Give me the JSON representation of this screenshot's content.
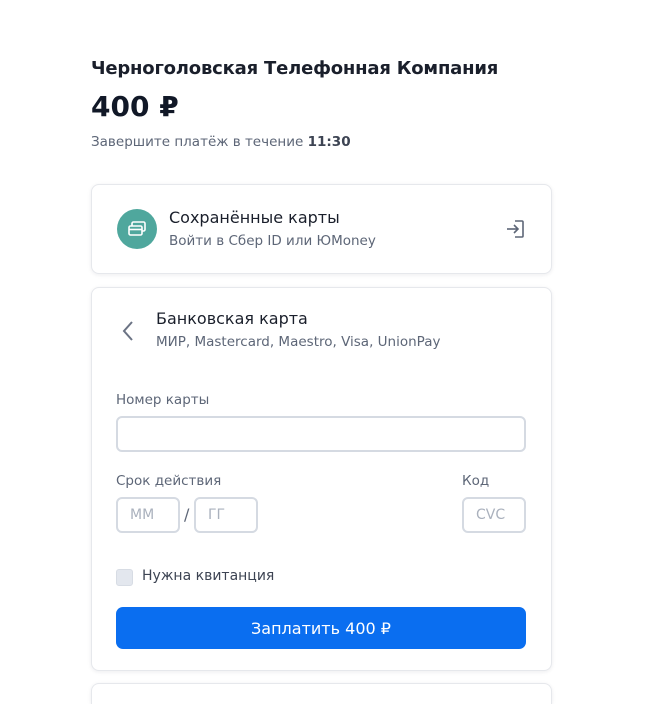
{
  "header": {
    "merchant": "Черноголовская Телефонная Компания",
    "amount": "400 ₽",
    "timer_text": "Завершите платёж в течение",
    "timer_value": "11:30"
  },
  "saved_cards": {
    "title": "Сохранённые карты",
    "subtitle": "Войти в Сбер ID или ЮMoney",
    "icon": "card-icon",
    "login_icon": "login-icon",
    "accent": "#4fa79d"
  },
  "bank_card": {
    "title": "Банковская карта",
    "subtitle": "МИР, Mastercard, Maestro, Visa, UnionPay",
    "card_number_label": "Номер карты",
    "card_number_value": "",
    "expiry_label": "Срок действия",
    "month_placeholder": "ММ",
    "year_placeholder": "ГГ",
    "separator": "/",
    "cvc_label": "Код",
    "cvc_placeholder": "CVC",
    "receipt_label": "Нужна квитанция",
    "receipt_checked": false,
    "pay_button": "Заплатить 400 ₽",
    "button_color": "#0a6ef0"
  }
}
